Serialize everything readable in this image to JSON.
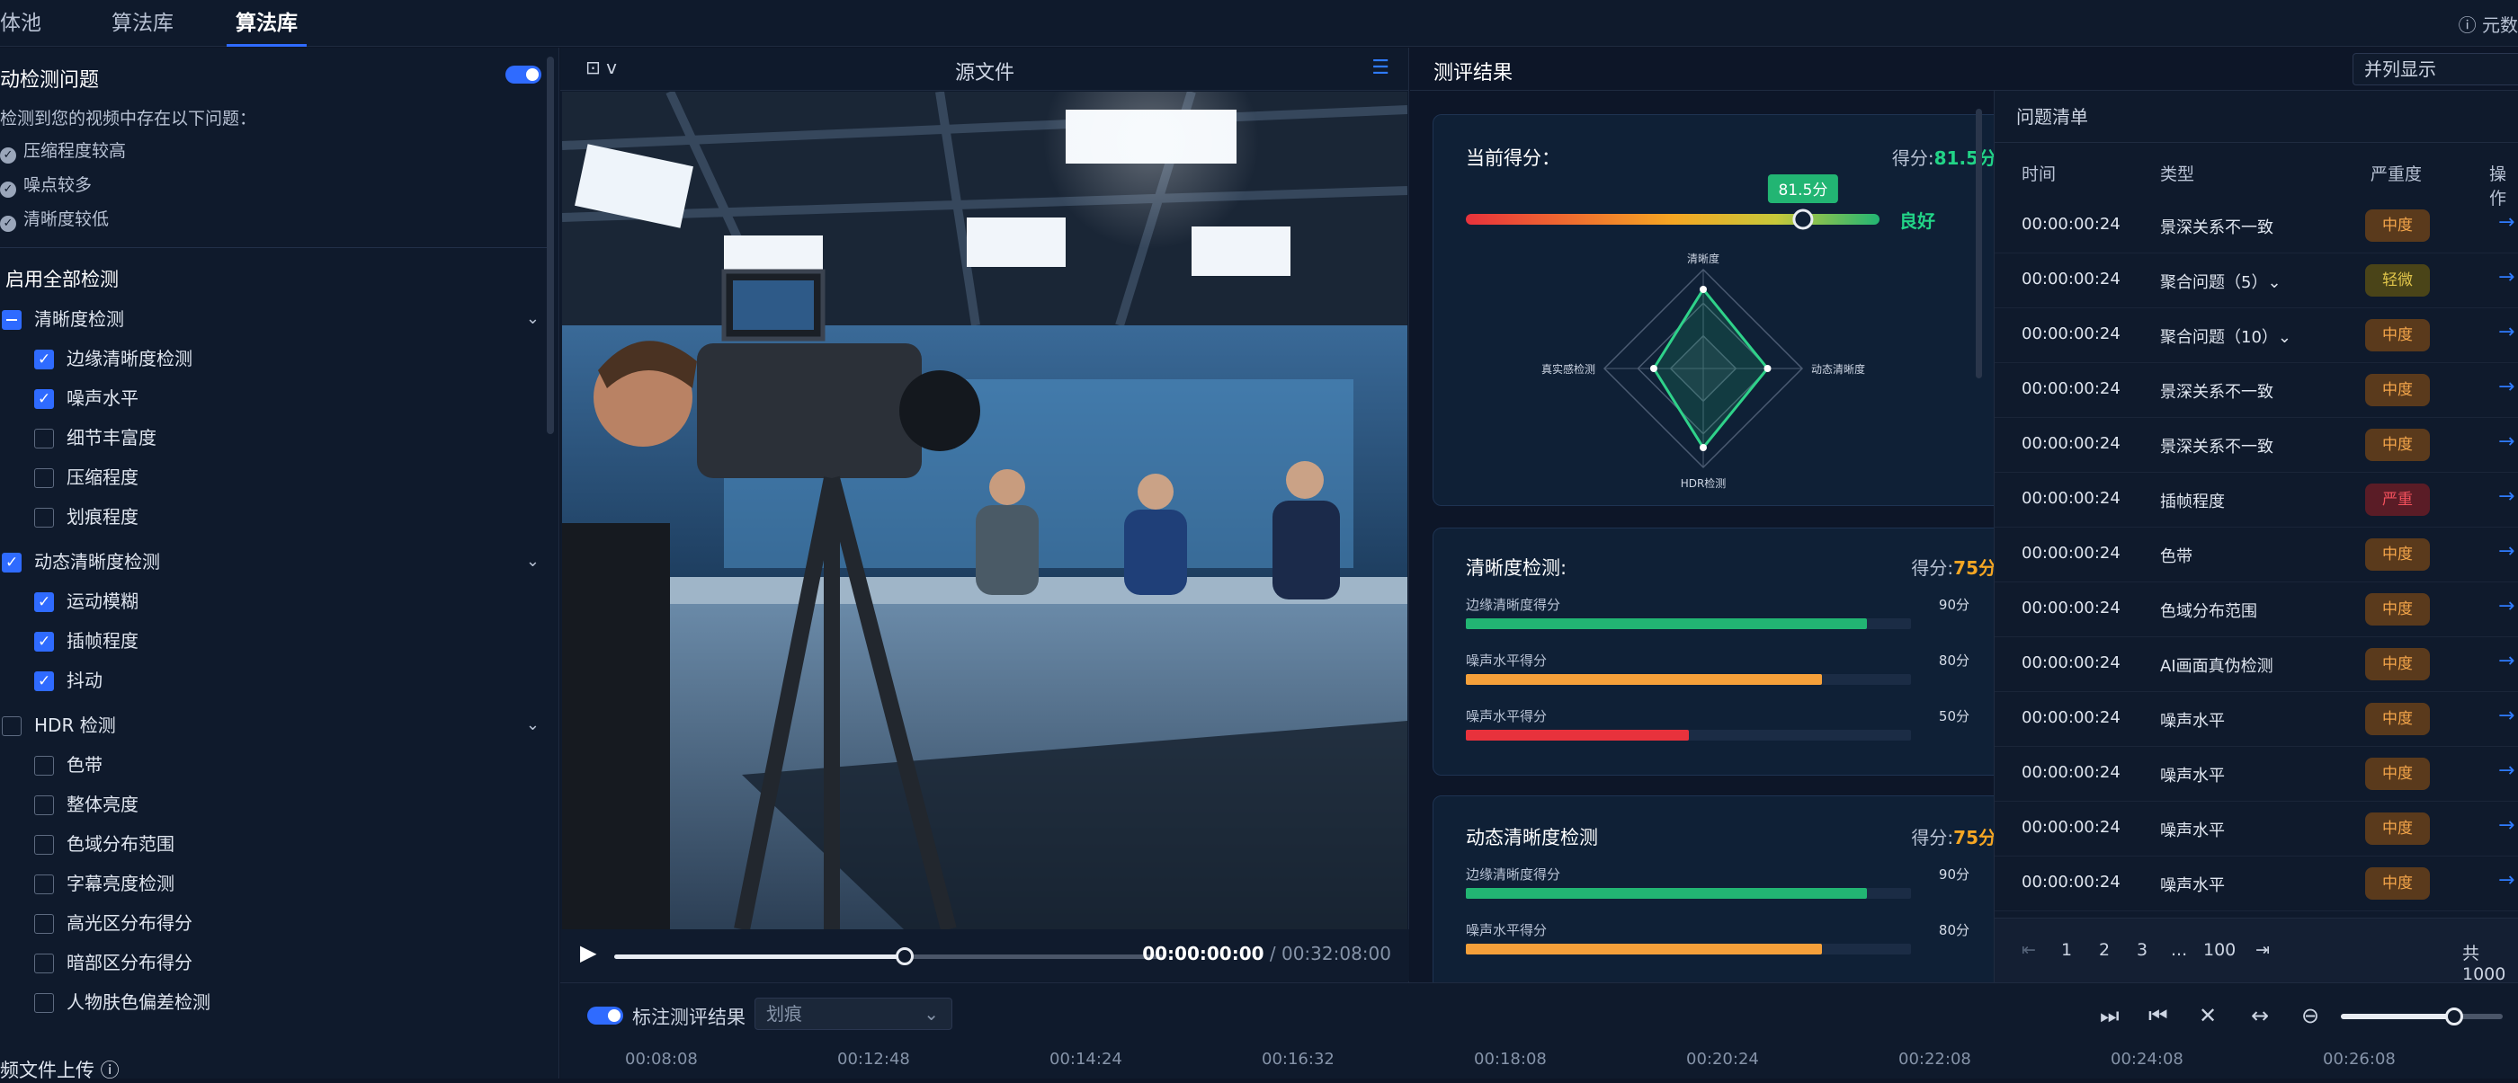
{
  "tabs": [
    "体池",
    "算法库",
    "算法库"
  ],
  "top_right": "ⓘ 元数",
  "sidebar": {
    "title": "动检测问题",
    "hint": "检测到您的视频中存在以下问题：",
    "problems": [
      "压缩程度较高",
      "噪点较多",
      "清晰度较低"
    ],
    "enable_all": "启用全部检测",
    "groups": [
      {
        "label": "清晰度检测",
        "state": "ind",
        "items": [
          {
            "label": "边缘清晰度检测",
            "on": true
          },
          {
            "label": "噪声水平",
            "on": true
          },
          {
            "label": "细节丰富度",
            "on": false
          },
          {
            "label": "压缩程度",
            "on": false
          },
          {
            "label": "划痕程度",
            "on": false
          }
        ]
      },
      {
        "label": "动态清晰度检测",
        "state": "on",
        "items": [
          {
            "label": "运动模糊",
            "on": true
          },
          {
            "label": "插帧程度",
            "on": true
          },
          {
            "label": "抖动",
            "on": true
          }
        ]
      },
      {
        "label": "HDR 检测",
        "state": "off",
        "items": [
          {
            "label": "色带",
            "on": false
          },
          {
            "label": "整体亮度",
            "on": false
          },
          {
            "label": "色域分布范围",
            "on": false
          },
          {
            "label": "字幕亮度检测",
            "on": false
          },
          {
            "label": "高光区分布得分",
            "on": false
          },
          {
            "label": "暗部区分布得分",
            "on": false
          },
          {
            "label": "人物肤色偏差检测",
            "on": false
          }
        ]
      }
    ],
    "upload": "频文件上传 ⓘ"
  },
  "source": {
    "title": "源文件",
    "cam_label": "⊡ v",
    "time_current": "00:00:00:00",
    "time_total": " / 00:32:08:00",
    "progress": 0.53
  },
  "results": {
    "title": "测评结果",
    "display_mode": "并列显示",
    "overall": {
      "label": "当前得分：",
      "score_prefix": "得分:",
      "score": "81.5分",
      "bubble": "81.5分",
      "grade": "良好",
      "value": 81.5
    },
    "radar_labels": [
      "清晰度",
      "动态清晰度",
      "HDR检测",
      "真实感检测"
    ],
    "radar_values": [
      0.8,
      0.65,
      0.8,
      0.5
    ],
    "clarity": {
      "title": "清晰度检测:",
      "score_prefix": "得分:",
      "score": "75分",
      "bars": [
        {
          "label": "边缘清晰度得分",
          "value_text": "90分",
          "value": 90,
          "color": "#22b573"
        },
        {
          "label": "噪声水平得分",
          "value_text": "80分",
          "value": 80,
          "color": "#f5a03a"
        },
        {
          "label": "噪声水平得分",
          "value_text": "50分",
          "value": 50,
          "color": "#e8323c"
        }
      ]
    },
    "dynamic": {
      "title": "动态清晰度检测",
      "score_prefix": "得分:",
      "score": "75分",
      "bars": [
        {
          "label": "边缘清晰度得分",
          "value_text": "90分",
          "value": 90,
          "color": "#22b573"
        },
        {
          "label": "噪声水平得分",
          "value_text": "80分",
          "value": 80,
          "color": "#f5a03a"
        }
      ]
    }
  },
  "issues": {
    "title": "问题清单",
    "headers": [
      "时间",
      "类型",
      "严重度",
      "操作"
    ],
    "rows": [
      {
        "time": "00:00:00:24",
        "type": "景深关系不一致",
        "severity": "中度",
        "level": "mid"
      },
      {
        "time": "00:00:00:24",
        "type": "聚合问题（5）⌄",
        "severity": "轻微",
        "level": "low"
      },
      {
        "time": "00:00:00:24",
        "type": "聚合问题（10）⌄",
        "severity": "中度",
        "level": "mid"
      },
      {
        "time": "00:00:00:24",
        "type": "景深关系不一致",
        "severity": "中度",
        "level": "mid"
      },
      {
        "time": "00:00:00:24",
        "type": "景深关系不一致",
        "severity": "中度",
        "level": "mid"
      },
      {
        "time": "00:00:00:24",
        "type": "插帧程度",
        "severity": "严重",
        "level": "high"
      },
      {
        "time": "00:00:00:24",
        "type": "色带",
        "severity": "中度",
        "level": "mid"
      },
      {
        "time": "00:00:00:24",
        "type": "色域分布范围",
        "severity": "中度",
        "level": "mid"
      },
      {
        "time": "00:00:00:24",
        "type": "AI画面真伪检测",
        "severity": "中度",
        "level": "mid"
      },
      {
        "time": "00:00:00:24",
        "type": "噪声水平",
        "severity": "中度",
        "level": "mid"
      },
      {
        "time": "00:00:00:24",
        "type": "噪声水平",
        "severity": "中度",
        "level": "mid"
      },
      {
        "time": "00:00:00:24",
        "type": "噪声水平",
        "severity": "中度",
        "level": "mid"
      },
      {
        "time": "00:00:00:24",
        "type": "噪声水平",
        "severity": "中度",
        "level": "mid"
      }
    ],
    "pager": {
      "pages": [
        "1",
        "2",
        "3",
        "...",
        "100"
      ],
      "total": "共1000"
    }
  },
  "timeline": {
    "toggle_label": "标注测评结果",
    "filter": "划痕",
    "ticks": [
      "00:08:08",
      "00:12:48",
      "00:14:24",
      "00:16:32",
      "00:18:08",
      "00:20:24",
      "00:22:08",
      "00:24:08",
      "00:26:08"
    ],
    "zoom": 0.7
  },
  "colors": {
    "accent": "#2f6bff",
    "panel": "#0f1a2c",
    "bg": "#0d1526",
    "green": "#22b573",
    "orange": "#f5a623",
    "red": "#e8323c"
  }
}
